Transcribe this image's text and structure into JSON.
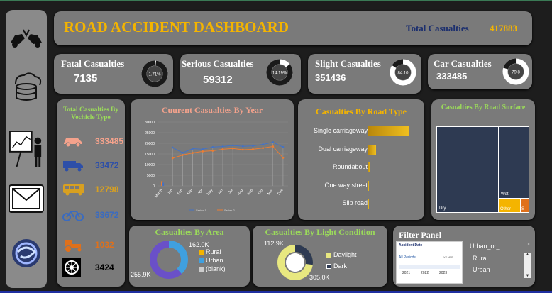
{
  "header": {
    "title": "ROAD ACCIDENT DASHBOARD",
    "total_label": "Total Casualties",
    "total_value": "417883"
  },
  "kpis": [
    {
      "label": "Fatal Casualties",
      "value": "7135",
      "pct_label": "1.71%",
      "pct": 1.71
    },
    {
      "label": "Serious Casualties",
      "value": "59312",
      "pct_label": "14.19%",
      "pct": 14.19
    },
    {
      "label": "Slight Casualties",
      "value": "351436",
      "pct_label": "84.10",
      "pct": 84.1
    },
    {
      "label": "Car Casualties",
      "value": "333485",
      "pct_label": "79.8",
      "pct": 79.8
    }
  ],
  "vehicles": {
    "title": "Total Casualties By Vechicle Type",
    "items": [
      {
        "icon": "car-icon",
        "value": "333485",
        "color": "#f4a28c"
      },
      {
        "icon": "truck-icon",
        "value": "33472",
        "color": "#2d4fa8"
      },
      {
        "icon": "bus-icon",
        "value": "12798",
        "color": "#d8a020"
      },
      {
        "icon": "bike-icon",
        "value": "33672",
        "color": "#3a6bc0"
      },
      {
        "icon": "tractor-icon",
        "value": "1032",
        "color": "#e0701a"
      },
      {
        "icon": "wheel-icon",
        "value": "3424",
        "color": "#000000"
      }
    ]
  },
  "year_chart": {
    "title": "Cuurent Casualties By Year",
    "y_ticks": [
      "30000",
      "25000",
      "20000",
      "15000",
      "10000",
      "5000",
      "0"
    ],
    "months": [
      "Month",
      "Jan",
      "Feb",
      "Mar",
      "Apr",
      "May",
      "Jun",
      "Jul",
      "Aug",
      "Sep",
      "Oct",
      "Nov",
      "Dec"
    ],
    "legend": [
      "Series 1",
      "Series 2"
    ]
  },
  "road_type": {
    "title": "Casualties By Road Type",
    "items": [
      {
        "label": "Single carriageway",
        "value": 0.95
      },
      {
        "label": "Dual carriageway",
        "value": 0.2
      },
      {
        "label": "Roundabout",
        "value": 0.06
      },
      {
        "label": "One way street",
        "value": 0.02
      },
      {
        "label": "Slip road",
        "value": 0.01
      }
    ]
  },
  "surface": {
    "title": "Casualties By Road Surface",
    "labels": [
      "Dry",
      "Wet",
      "Other",
      "S"
    ]
  },
  "area": {
    "title": "Casualties By Area",
    "top_value": "162.0K",
    "bottom_value": "255.9K",
    "legend": [
      "Rural",
      "Urban",
      "(blank)"
    ]
  },
  "light": {
    "title": "Casualties By Light Condition",
    "top_value": "112.9K",
    "bottom_value": "305.0K",
    "legend": [
      "Daylight",
      "Dark"
    ]
  },
  "filter": {
    "title": "Filter Panel",
    "date_label": "Accident Date",
    "periods": "All Periods",
    "years_label": "YEARS",
    "years": [
      "2021",
      "2022",
      "2023"
    ],
    "slicer_title": "Urban_or_...",
    "options": [
      "Rural",
      "Urban"
    ]
  },
  "chart_data": {
    "type": "line",
    "categories": [
      "Jan",
      "Feb",
      "Mar",
      "Apr",
      "May",
      "Jun",
      "Jul",
      "Aug",
      "Sep",
      "Oct",
      "Nov",
      "Dec"
    ],
    "ylim": [
      0,
      30000
    ],
    "series": [
      {
        "name": "Series 1",
        "values": [
          18000,
          15500,
          17500,
          17200,
          18200,
          18500,
          19000,
          18600,
          18800,
          19500,
          20500,
          18200
        ]
      },
      {
        "name": "Series 2",
        "values": [
          13000,
          14500,
          15500,
          16200,
          16500,
          17200,
          17600,
          17000,
          17200,
          17800,
          18500,
          13200
        ]
      }
    ]
  }
}
